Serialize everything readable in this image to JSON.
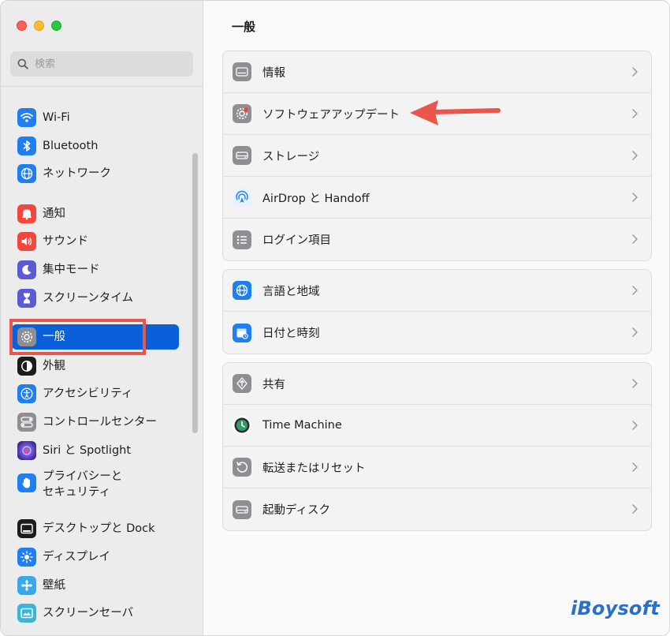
{
  "search": {
    "placeholder": "検索"
  },
  "sidebar": {
    "items": [
      {
        "label": "Wi-Fi",
        "icon": "wifi-icon",
        "color": "#1f7ef0"
      },
      {
        "label": "Bluetooth",
        "icon": "bluetooth-icon",
        "color": "#1f7ef0"
      },
      {
        "label": "ネットワーク",
        "icon": "globe-icon",
        "color": "#1f7ef0"
      },
      {
        "label": "通知",
        "icon": "bell-icon",
        "color": "#f2473d"
      },
      {
        "label": "サウンド",
        "icon": "speaker-icon",
        "color": "#f2473d"
      },
      {
        "label": "集中モード",
        "icon": "moon-icon",
        "color": "#5b5bd6"
      },
      {
        "label": "スクリーンタイム",
        "icon": "hourglass-icon",
        "color": "#5b5bd6"
      },
      {
        "label": "一般",
        "icon": "gear-icon",
        "color": "#8e8e93",
        "selected": true
      },
      {
        "label": "外観",
        "icon": "appearance-icon",
        "color": "#1c1c1e"
      },
      {
        "label": "アクセシビリティ",
        "icon": "accessibility-icon",
        "color": "#1f7ef0"
      },
      {
        "label": "コントロールセンター",
        "icon": "control-center-icon",
        "color": "#8e8e93"
      },
      {
        "label": "Siri と Spotlight",
        "icon": "siri-icon",
        "color": "#3a2a7a"
      },
      {
        "label": "プライバシーと\nセキュリティ",
        "icon": "hand-icon",
        "color": "#1f7ef0"
      },
      {
        "label": "デスクトップと Dock",
        "icon": "dock-icon",
        "color": "#1c1c1e"
      },
      {
        "label": "ディスプレイ",
        "icon": "sun-icon",
        "color": "#1f7ef0"
      },
      {
        "label": "壁紙",
        "icon": "wallpaper-icon",
        "color": "#39a8e8"
      },
      {
        "label": "スクリーンセーバ",
        "icon": "screensaver-icon",
        "color": "#39b6d8"
      }
    ]
  },
  "main": {
    "title": "一般",
    "groups": [
      [
        {
          "label": "情報",
          "icon": "info-device-icon"
        },
        {
          "label": "ソフトウェアアップデート",
          "icon": "software-update-icon"
        },
        {
          "label": "ストレージ",
          "icon": "storage-icon"
        },
        {
          "label": "AirDrop と Handoff",
          "icon": "airdrop-icon"
        },
        {
          "label": "ログイン項目",
          "icon": "login-items-icon"
        }
      ],
      [
        {
          "label": "言語と地域",
          "icon": "language-globe-icon"
        },
        {
          "label": "日付と時刻",
          "icon": "calendar-clock-icon"
        }
      ],
      [
        {
          "label": "共有",
          "icon": "sharing-icon"
        },
        {
          "label": "Time Machine",
          "icon": "time-machine-icon"
        },
        {
          "label": "転送またはリセット",
          "icon": "transfer-reset-icon"
        },
        {
          "label": "起動ディスク",
          "icon": "startup-disk-icon"
        }
      ]
    ]
  },
  "brand": "iBoysoft",
  "colors": {
    "accent": "#0a60d8",
    "annotation": "#e8574a",
    "brand": "#2a6fc9"
  }
}
